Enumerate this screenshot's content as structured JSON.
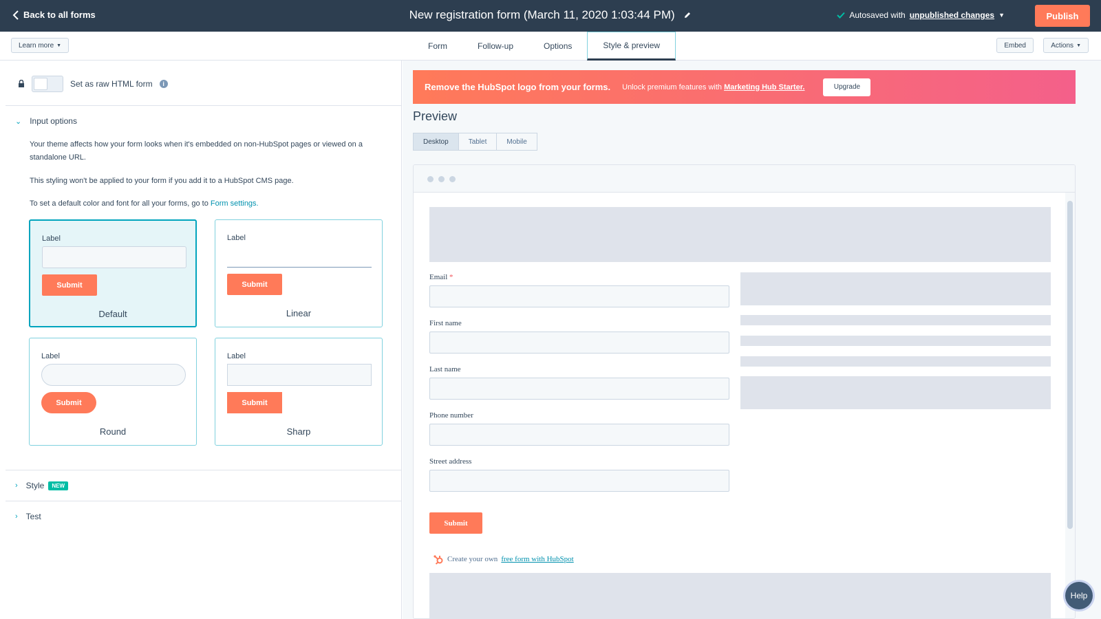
{
  "topbar": {
    "back_label": "Back to all forms",
    "title": "New registration form (March 11, 2020 1:03:44 PM)",
    "autosave_prefix": "Autosaved with",
    "autosave_link": "unpublished changes",
    "publish_label": "Publish"
  },
  "subnav": {
    "learn_more": "Learn more",
    "tabs": [
      {
        "label": "Form"
      },
      {
        "label": "Follow-up"
      },
      {
        "label": "Options"
      },
      {
        "label": "Style & preview"
      }
    ],
    "active_tab": "Style & preview",
    "embed": "Embed",
    "actions": "Actions"
  },
  "left": {
    "raw_html_label": "Set as raw HTML form",
    "input_options": {
      "heading": "Input options",
      "p1": "Your theme affects how your form looks when it's embedded on non-HubSpot pages or viewed on a standalone URL.",
      "p2": "This styling won't be applied to your form if you add it to a HubSpot CMS page.",
      "p3_prefix": "To set a default color and font for all your forms, go to",
      "p3_link": "Form settings.",
      "cards": [
        {
          "name": "Default",
          "label": "Label",
          "submit": "Submit"
        },
        {
          "name": "Linear",
          "label": "Label",
          "submit": "Submit"
        },
        {
          "name": "Round",
          "label": "Label",
          "submit": "Submit"
        },
        {
          "name": "Sharp",
          "label": "Label",
          "submit": "Submit"
        }
      ],
      "selected": "Default"
    },
    "style_section": "Style",
    "style_badge": "NEW",
    "test_section": "Test"
  },
  "right": {
    "banner": {
      "headline": "Remove the HubSpot logo from your forms.",
      "text_prefix": "Unlock premium features with",
      "text_link": "Marketing Hub Starter.",
      "button": "Upgrade"
    },
    "preview_title": "Preview",
    "devices": [
      "Desktop",
      "Tablet",
      "Mobile"
    ],
    "active_device": "Desktop",
    "form": {
      "fields": [
        {
          "label": "Email",
          "required": "*"
        },
        {
          "label": "First name"
        },
        {
          "label": "Last name"
        },
        {
          "label": "Phone number"
        },
        {
          "label": "Street address"
        }
      ],
      "submit": "Submit",
      "credit_prefix": "Create your own",
      "credit_link": "free form with HubSpot"
    }
  },
  "help_label": "Help",
  "colors": {
    "topbar": "#2d3e50",
    "accent": "#ff7a59",
    "teal": "#00a4bd",
    "badge": "#00bda5"
  }
}
